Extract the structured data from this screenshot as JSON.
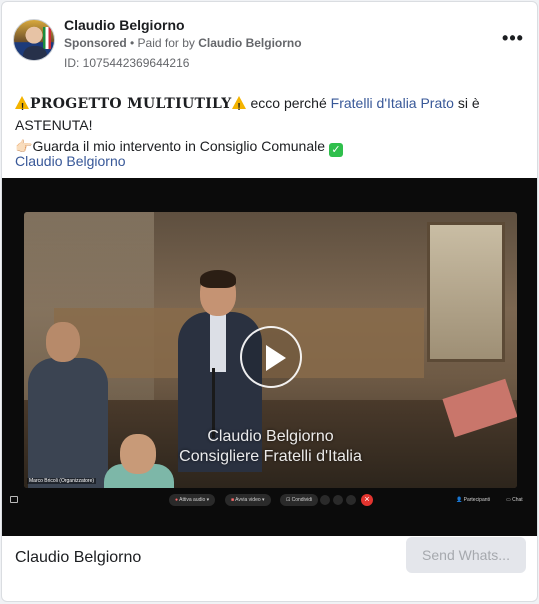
{
  "post": {
    "author": "Claudio Belgiorno",
    "sponsored": "Sponsored",
    "separator": " • ",
    "paid_for_prefix": "Paid for by ",
    "payer": "Claudio Belgiorno",
    "ad_id": "ID: 1075442369644216",
    "more_icon": "more-dots-icon"
  },
  "body": {
    "line1_headline": "PROGETTO MULTIUTILY",
    "line1_mid": "  ecco perché ",
    "line1_link": "Fratelli d'Italia Prato",
    "line1_tail": " si è ASTENUTA!",
    "line2_text": "Guarda il mio intervento in Consiglio Comunale",
    "pointer_glyph": "👉🏻",
    "check_glyph": "✓"
  },
  "page_link": "Claudio Belgiorno",
  "video": {
    "caption_line1": "Claudio Belgiorno",
    "caption_line2": "Consigliere Fratelli d'Italia",
    "nametag": "Marco Bricoli (Organizzatore)",
    "toolbar": {
      "audio": "Attiva audio",
      "video": "Avvia video",
      "share": "Condividi",
      "participants": "Partecipanti",
      "chat": "Chat"
    }
  },
  "footer": {
    "name": "Claudio Belgiorno",
    "cta": "Send Whats..."
  },
  "colors": {
    "link": "#385898",
    "meta": "#65676b",
    "cta_bg": "#e4e6eb",
    "end_call": "#e3342f"
  }
}
